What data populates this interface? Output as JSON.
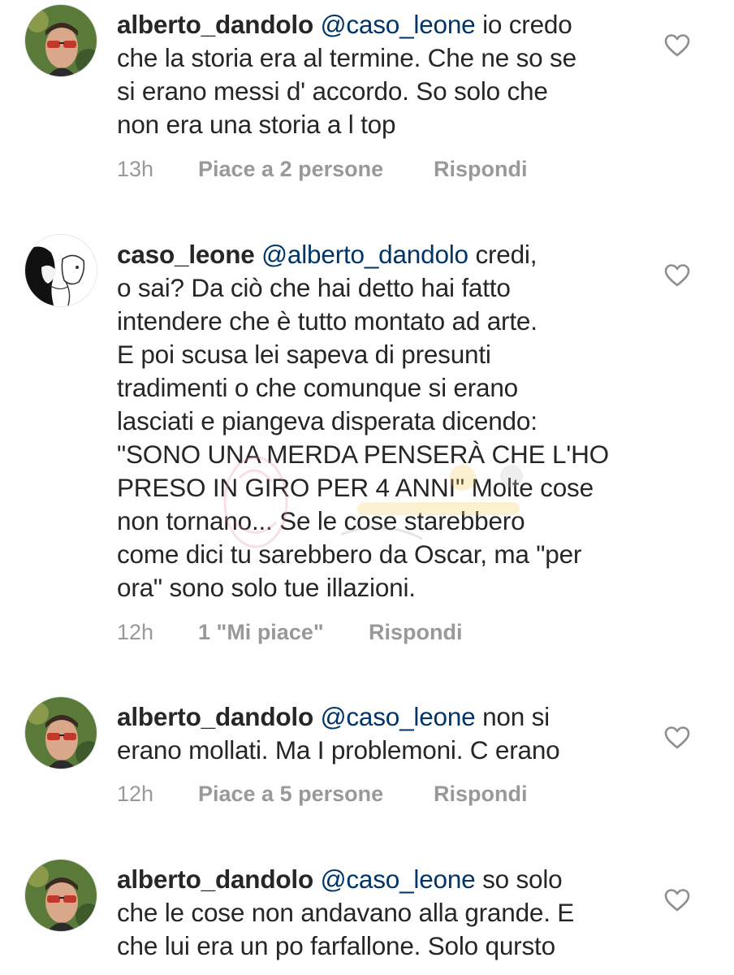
{
  "comments": [
    {
      "username": "alberto_dandolo",
      "mention": "@caso_leone",
      "line1_rest": " io credo",
      "body_lines": [
        "che la storia era al termine. Che ne so se",
        "si erano messi d' accordo. So solo che",
        "non era una storia a l top"
      ],
      "time": "13h",
      "likes": "Piace a 2 persone",
      "reply": "Rispondi",
      "avatar": "avatar-sunglasses-man"
    },
    {
      "username": "caso_leone",
      "mention": "@alberto_dandolo",
      "line1_rest": " credi,",
      "body_lines": [
        "o sai? Da ciò che hai detto hai fatto",
        "intendere che è tutto montato ad arte.",
        "E poi scusa lei sapeva di presunti",
        "tradimenti o che comunque si erano",
        "lasciati e piangeva disperata dicendo:",
        "\"SONO UNA MERDA PENSERÀ CHE L'HO",
        "PRESO IN GIRO PER 4 ANNI\" Molte cose",
        "non tornano... Se le cose starebbero",
        "come dici tu sarebbero da Oscar, ma \"per",
        "ora\" sono solo tue illazioni."
      ],
      "time": "12h",
      "likes": "1 \"Mi piace\"",
      "reply": "Rispondi",
      "avatar": "avatar-couple-drawing"
    },
    {
      "username": "alberto_dandolo",
      "mention": "@caso_leone",
      "line1_rest": " non si",
      "body_lines": [
        "erano mollati. Ma I problemoni. C erano"
      ],
      "time": "12h",
      "likes": "Piace a 5 persone",
      "reply": "Rispondi",
      "avatar": "avatar-sunglasses-man"
    },
    {
      "username": "alberto_dandolo",
      "mention": "@caso_leone",
      "line1_rest": " so solo",
      "body_lines": [
        "che le cose non andavano alla grande. E",
        "che lui era un po farfallone. Solo qursto"
      ],
      "time": "",
      "likes": "",
      "reply": "",
      "avatar": "avatar-sunglasses-man"
    }
  ],
  "icons": {
    "like": "heart-outline-icon"
  },
  "colors": {
    "text": "#262626",
    "mention": "#003569",
    "meta": "#999999",
    "heart_stroke": "#8e8e8e"
  }
}
